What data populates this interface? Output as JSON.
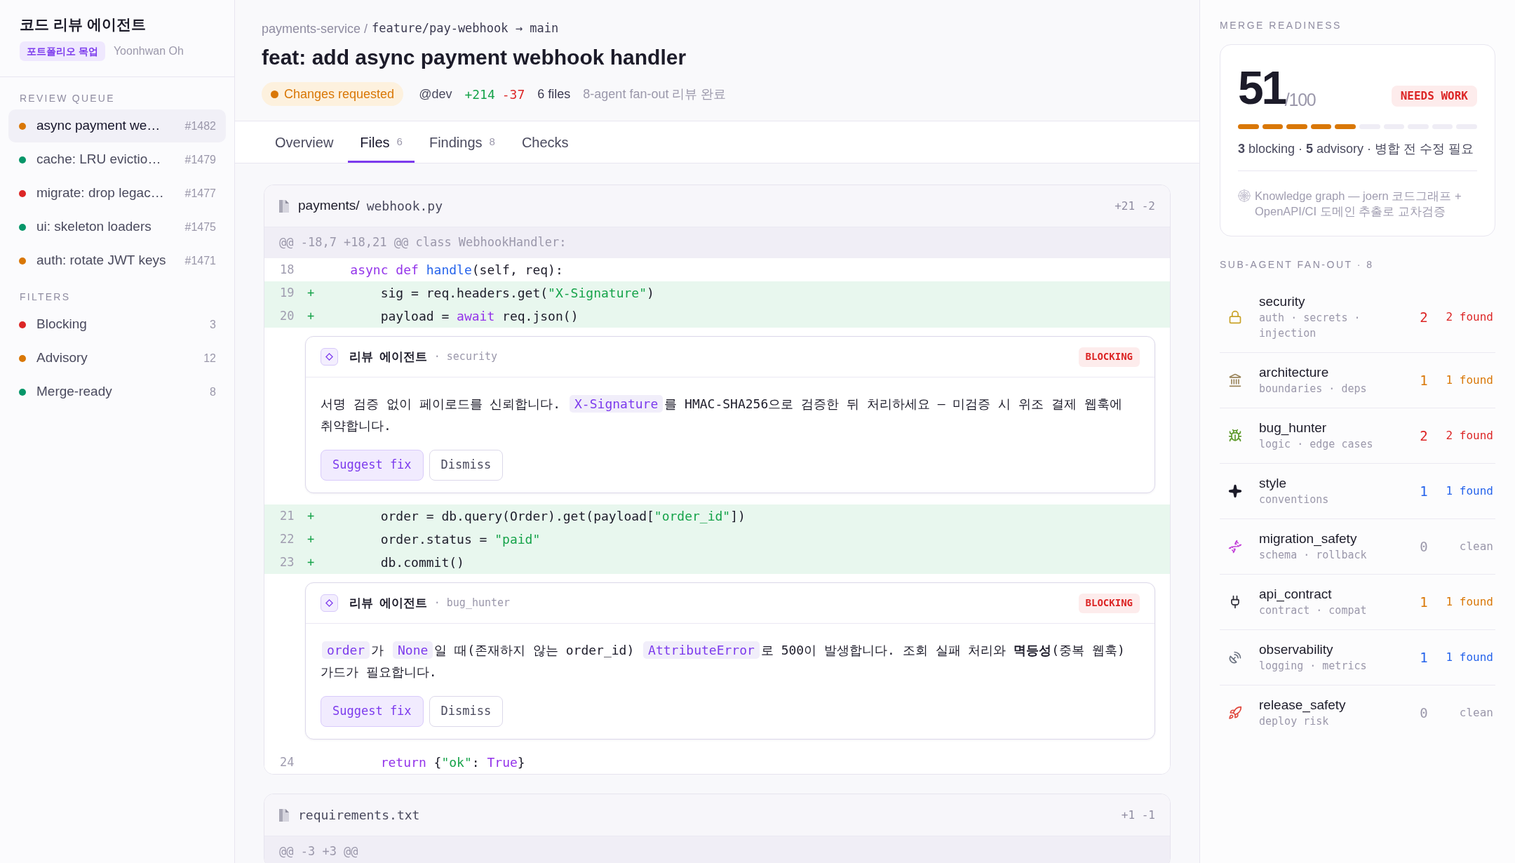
{
  "sidebar": {
    "title": "코드 리뷰 에이전트",
    "badge": "포트폴리오 목업",
    "author": "Yoonhwan Oh",
    "queue_heading": "REVIEW QUEUE",
    "queue": [
      {
        "title": "async payment we…",
        "number": "#1482",
        "color": "#d97706",
        "selected": true
      },
      {
        "title": "cache: LRU evictio…",
        "number": "#1479",
        "color": "#059669",
        "selected": false
      },
      {
        "title": "migrate: drop legac…",
        "number": "#1477",
        "color": "#dc2626",
        "selected": false
      },
      {
        "title": "ui: skeleton loaders",
        "number": "#1475",
        "color": "#059669",
        "selected": false
      },
      {
        "title": "auth: rotate JWT keys",
        "number": "#1471",
        "color": "#d97706",
        "selected": false
      }
    ],
    "filters_heading": "FILTERS",
    "filters": [
      {
        "label": "Blocking",
        "count": "3",
        "color": "#dc2626"
      },
      {
        "label": "Advisory",
        "count": "12",
        "color": "#d97706"
      },
      {
        "label": "Merge-ready",
        "count": "8",
        "color": "#059669"
      }
    ]
  },
  "pr": {
    "repo": "payments-service /",
    "branch": "feature/pay-webhook → main",
    "title": "feat: add async payment webhook handler",
    "status": "Changes requested",
    "author": "@dev",
    "additions": "+214",
    "deletions": "-37",
    "files": "6 files",
    "note": "8-agent fan-out 리뷰 완료"
  },
  "tabs": [
    {
      "label": "Overview",
      "selected": false
    },
    {
      "label": "Files",
      "count": "6",
      "selected": true
    },
    {
      "label": "Findings",
      "count": "8",
      "selected": false
    },
    {
      "label": "Checks",
      "selected": false
    }
  ],
  "files": [
    {
      "folder": "payments/",
      "name": "webhook.py",
      "stats": "+21 -2",
      "hunk": "@@ -18,7 +18,21 @@ class WebhookHandler:",
      "rows": [
        {
          "kind": "line",
          "number": "18",
          "added": false,
          "tokens": [
            {
              "text": "    async def ",
              "kind": "keyword"
            },
            {
              "text": "handle",
              "kind": "function"
            },
            {
              "text": "(self, req):",
              "kind": "plain"
            }
          ]
        },
        {
          "kind": "line",
          "number": "19",
          "added": true,
          "marker": "+",
          "tokens": [
            {
              "text": "        sig = req.headers.get(",
              "kind": "plain"
            },
            {
              "text": "\"X-Signature\"",
              "kind": "string"
            },
            {
              "text": ")",
              "kind": "plain"
            }
          ]
        },
        {
          "kind": "line",
          "number": "20",
          "added": true,
          "marker": "+",
          "tokens": [
            {
              "text": "        payload = ",
              "kind": "plain"
            },
            {
              "text": "await",
              "kind": "keyword"
            },
            {
              "text": " req.json()",
              "kind": "plain"
            }
          ]
        },
        {
          "kind": "finding",
          "author": "리뷰 에이전트",
          "agent": "· security",
          "severity": "BLOCKING",
          "message": [
            {
              "kind": "text",
              "text": "서명 검증 없이 페이로드를 신뢰합니다. "
            },
            {
              "kind": "code",
              "text": "X-Signature"
            },
            {
              "kind": "text",
              "text": "를 HMAC-SHA256으로 검증한 뒤 처리하세요 — 미검증 시 위조 결제 웹훅에 취약합니다."
            }
          ],
          "actions": [
            {
              "label": "Suggest fix",
              "kind": "primary"
            },
            {
              "label": "Dismiss",
              "kind": "secondary"
            }
          ]
        },
        {
          "kind": "line",
          "number": "21",
          "added": true,
          "marker": "+",
          "tokens": [
            {
              "text": "        order = db.query(Order).get(payload[",
              "kind": "plain"
            },
            {
              "text": "\"order_id\"",
              "kind": "string"
            },
            {
              "text": "])",
              "kind": "plain"
            }
          ]
        },
        {
          "kind": "line",
          "number": "22",
          "added": true,
          "marker": "+",
          "tokens": [
            {
              "text": "        order.status = ",
              "kind": "plain"
            },
            {
              "text": "\"paid\"",
              "kind": "string"
            }
          ]
        },
        {
          "kind": "line",
          "number": "23",
          "added": true,
          "marker": "+",
          "tokens": [
            {
              "text": "        db.commit()",
              "kind": "plain"
            }
          ]
        },
        {
          "kind": "finding",
          "author": "리뷰 에이전트",
          "agent": "· bug_hunter",
          "severity": "BLOCKING",
          "message": [
            {
              "kind": "code",
              "text": "order"
            },
            {
              "kind": "text",
              "text": "가 "
            },
            {
              "kind": "code",
              "text": "None"
            },
            {
              "kind": "text",
              "text": "일 때(존재하지 않는 order_id) "
            },
            {
              "kind": "code",
              "text": "AttributeError"
            },
            {
              "kind": "text",
              "text": "로 500이 발생합니다. 조회 실패 처리와 **멱등성**(중복 웹훅) 가드가 필요합니다."
            }
          ],
          "actions": [
            {
              "label": "Suggest fix",
              "kind": "primary"
            },
            {
              "label": "Dismiss",
              "kind": "secondary"
            }
          ]
        },
        {
          "kind": "line",
          "number": "24",
          "added": false,
          "tokens": [
            {
              "text": "        return",
              "kind": "keyword"
            },
            {
              "text": " {",
              "kind": "plain"
            },
            {
              "text": "\"ok\"",
              "kind": "string"
            },
            {
              "text": ": ",
              "kind": "plain"
            },
            {
              "text": "True",
              "kind": "keyword"
            },
            {
              "text": "}",
              "kind": "plain"
            }
          ]
        }
      ]
    },
    {
      "name": "requirements.txt",
      "stats": "+1 -1",
      "hunk": "@@ -3 +3 @@"
    }
  ],
  "readiness": {
    "heading": "MERGE READINESS",
    "score": "51",
    "max": "/100",
    "badge": "NEEDS WORK",
    "level": 0.5,
    "summary": "**3** blocking · **5** advisory · 병합 전 수정 필요",
    "note": "Knowledge graph — joern 코드그래프 + OpenAPI/CI 도메인 추출로 교차검증"
  },
  "agents": {
    "heading": "SUB-AGENT FAN-OUT · 8",
    "items": [
      {
        "name": "security",
        "tags": "auth · secrets · injection",
        "count": "2",
        "status": "2 found",
        "color": "#dc2626"
      },
      {
        "name": "architecture",
        "tags": "boundaries · deps",
        "count": "1",
        "status": "1 found",
        "color": "#d97706"
      },
      {
        "name": "bug_hunter",
        "tags": "logic · edge cases",
        "count": "2",
        "status": "2 found",
        "color": "#dc2626"
      },
      {
        "name": "style",
        "tags": "conventions",
        "count": "1",
        "status": "1 found",
        "color": "#2563eb"
      },
      {
        "name": "migration_safety",
        "tags": "schema · rollback",
        "count": "0",
        "status": "clean",
        "color": "#9b98ab"
      },
      {
        "name": "api_contract",
        "tags": "contract · compat",
        "count": "1",
        "status": "1 found",
        "color": "#d97706"
      },
      {
        "name": "observability",
        "tags": "logging · metrics",
        "count": "1",
        "status": "1 found",
        "color": "#2563eb"
      },
      {
        "name": "release_safety",
        "tags": "deploy risk",
        "count": "0",
        "status": "clean",
        "color": "#9b98ab"
      }
    ]
  }
}
